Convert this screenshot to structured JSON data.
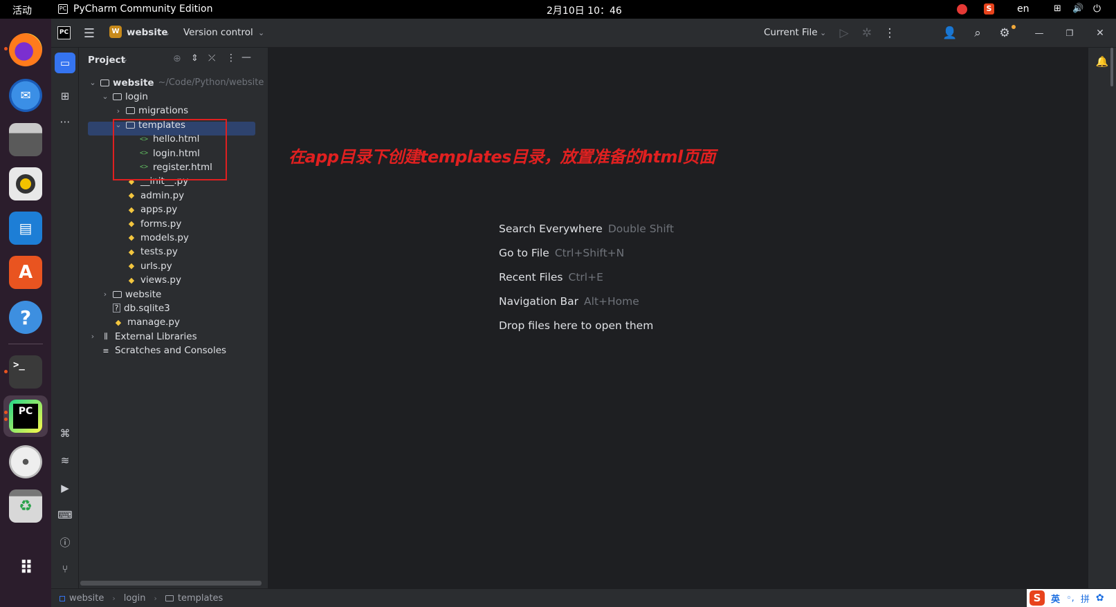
{
  "topbar": {
    "activities": "活动",
    "app_name": "PyCharm Community Edition",
    "clock": "2月10日 10：46",
    "lang": "en"
  },
  "dock": {
    "apps": [
      "firefox-icon",
      "thunderbird-icon",
      "files-icon",
      "rhythmbox-icon",
      "writer-icon",
      "app-center-icon",
      "help-icon",
      "terminal-icon",
      "pycharm-icon",
      "dvd-icon",
      "trash-icon",
      "show-apps-icon"
    ],
    "pycharm_label": "PC"
  },
  "header": {
    "logo": "PC",
    "project_badge": "W",
    "project_name": "website",
    "vcs": "Version control",
    "run_config": "Current File"
  },
  "project_panel": {
    "title": "Project",
    "tree": [
      {
        "name": "website",
        "hint": "~/Code/Python/website",
        "type": "folder",
        "level": 0,
        "expanded": true
      },
      {
        "name": "login",
        "type": "folder",
        "level": 1,
        "expanded": true
      },
      {
        "name": "migrations",
        "type": "folder",
        "level": 2,
        "expanded": false
      },
      {
        "name": "templates",
        "type": "folder",
        "level": 2,
        "expanded": true,
        "selected": true
      },
      {
        "name": "hello.html",
        "type": "html",
        "level": 3
      },
      {
        "name": "login.html",
        "type": "html",
        "level": 3
      },
      {
        "name": "register.html",
        "type": "html",
        "level": 3
      },
      {
        "name": "__init__.py",
        "type": "py",
        "level": 2
      },
      {
        "name": "admin.py",
        "type": "py",
        "level": 2
      },
      {
        "name": "apps.py",
        "type": "py",
        "level": 2
      },
      {
        "name": "forms.py",
        "type": "py",
        "level": 2
      },
      {
        "name": "models.py",
        "type": "py",
        "level": 2
      },
      {
        "name": "tests.py",
        "type": "py",
        "level": 2
      },
      {
        "name": "urls.py",
        "type": "py",
        "level": 2
      },
      {
        "name": "views.py",
        "type": "py",
        "level": 2
      },
      {
        "name": "website",
        "type": "folder",
        "level": 1,
        "expanded": false
      },
      {
        "name": "db.sqlite3",
        "type": "db",
        "level": 1
      },
      {
        "name": "manage.py",
        "type": "py",
        "level": 1
      },
      {
        "name": "External Libraries",
        "type": "lib",
        "level": 0,
        "expanded": false
      },
      {
        "name": "Scratches and Consoles",
        "type": "scratch",
        "level": 0
      }
    ]
  },
  "annotation": "在app目录下创建templates目录，放置准备的html页面",
  "editor_hints": [
    {
      "label": "Search Everywhere",
      "key": "Double Shift"
    },
    {
      "label": "Go to File",
      "key": "Ctrl+Shift+N"
    },
    {
      "label": "Recent Files",
      "key": "Ctrl+E"
    },
    {
      "label": "Navigation Bar",
      "key": "Alt+Home"
    },
    {
      "label": "Drop files here to open them",
      "key": ""
    }
  ],
  "statusbar": {
    "crumbs": [
      "website",
      "login",
      "templates"
    ],
    "ime": [
      "英",
      "拼"
    ]
  },
  "colors": {
    "accent": "#3574f0",
    "annotation": "#e02020",
    "selection": "#2e436e"
  }
}
